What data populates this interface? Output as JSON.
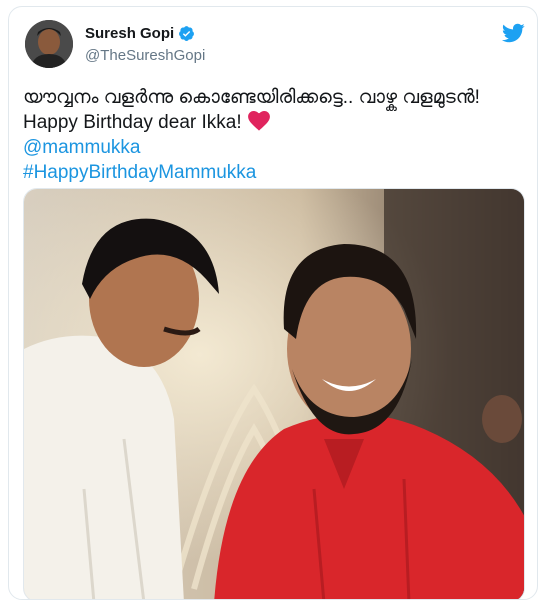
{
  "tweet": {
    "display_name": "Suresh Gopi",
    "handle": "@TheSureshGopi",
    "verified": true,
    "text_line1": "യൗവ്വനം വളർന്നു കൊണ്ടേയിരിക്കട്ടെ.. വാഴ്ക വളമുടൻ!",
    "text_line2": "Happy Birthday dear Ikka!",
    "mention": "@mammukka",
    "hashtag": "#HappyBirthdayMammukka"
  },
  "icons": {
    "platform": "twitter-bird-icon",
    "verified": "verified-badge-icon",
    "emoji": "red-heart-icon"
  },
  "colors": {
    "link": "#1b95e0",
    "twitter_blue": "#1da1f2",
    "heart": "#e0245e"
  }
}
